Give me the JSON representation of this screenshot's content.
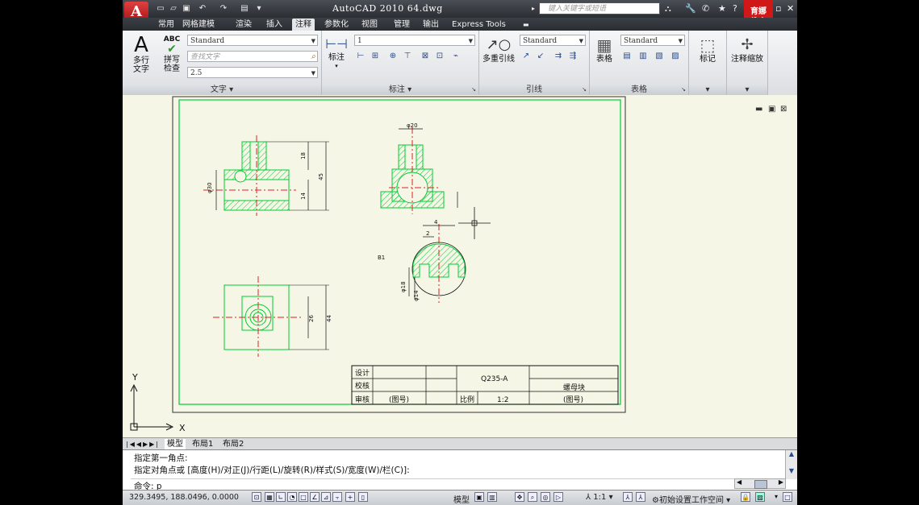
{
  "titlebar": {
    "logo": "A",
    "title": "AutoCAD 2010   64.dwg",
    "search_placeholder": "键入关键字或短语",
    "brand_line1": "育娜",
    "brand_line2": "教育"
  },
  "tabs": [
    "常用",
    "网格建模",
    "渲染",
    "插入",
    "注释",
    "参数化",
    "视图",
    "管理",
    "输出",
    "Express Tools"
  ],
  "active_tab": "注释",
  "ribbon": {
    "text_panel": {
      "mtext_label": "多行\n文字",
      "spell_label": "拼写\n检查",
      "spell_icon_text": "ABC",
      "style_combo": "Standard",
      "find_placeholder": "查找文字",
      "height_combo": "2.5",
      "label": "文字"
    },
    "dim_panel": {
      "dim_label": "标注",
      "style_combo": "1",
      "label": "标注"
    },
    "leader_panel": {
      "mleader_label": "多重引线",
      "style_combo": "Standard",
      "label": "引线"
    },
    "table_panel": {
      "table_label": "表格",
      "style_combo": "Standard",
      "label": "表格"
    },
    "markup_panel": {
      "label": "标记"
    },
    "scale_panel": {
      "label": "注释缩放"
    }
  },
  "drawing": {
    "dim_phi20": "φ20",
    "dim_phi30": "φ30",
    "dim_18": "18",
    "dim_45": "45",
    "dim_14": "14",
    "dim_4": "4",
    "dim_2": "2",
    "dim_phi18": "φ18",
    "dim_phi14": "φ14",
    "dim_26": "26",
    "dim_44": "44",
    "dim_b": "B1",
    "title_block": {
      "design": "设计",
      "check": "校核",
      "review": "审核",
      "drawing_no": "(图号)",
      "material": "Q235-A",
      "scale_label": "比例",
      "scale_value": "1:2",
      "part_name": "螺母块",
      "drawing_no2": "(图号)"
    },
    "axis_y": "Y",
    "axis_x": "X"
  },
  "layout_tabs": [
    "模型",
    "布局1",
    "布局2"
  ],
  "command": {
    "line1": "指定第一角点:",
    "line2": "指定对角点或 [高度(H)/对正(J)/行距(L)/旋转(R)/样式(S)/宽度(W)/栏(C)]:",
    "prompt": "命令: p"
  },
  "status": {
    "coords": "329.3495, 188.0496, 0.0000",
    "model_label": "模型",
    "scale_label": "1:1",
    "workspace_label": "初始设置工作空间"
  },
  "colors": {
    "title_bg": "#2b2e33",
    "draw_bg": "#f6f6e6",
    "geometry": "#00cc33",
    "centerline": "#e02020",
    "dimension": "#111111"
  }
}
